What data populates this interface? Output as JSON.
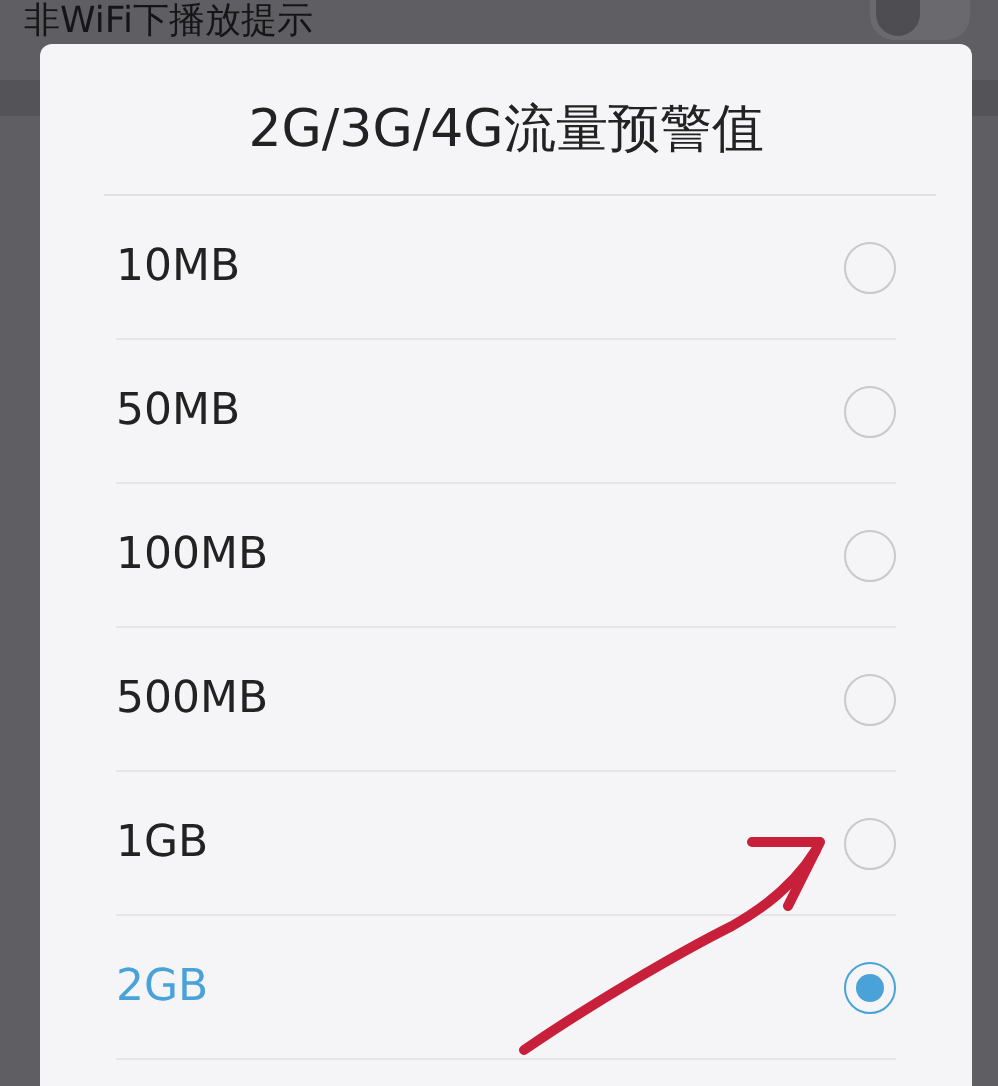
{
  "background_setting": {
    "label": "非WiFi下播放提示",
    "on": false
  },
  "dialog": {
    "title": "2G/3G/4G流量预警值",
    "options": [
      {
        "label": "10MB",
        "selected": false
      },
      {
        "label": "50MB",
        "selected": false
      },
      {
        "label": "100MB",
        "selected": false
      },
      {
        "label": "500MB",
        "selected": false
      },
      {
        "label": "1GB",
        "selected": false
      },
      {
        "label": "2GB",
        "selected": true
      }
    ]
  }
}
